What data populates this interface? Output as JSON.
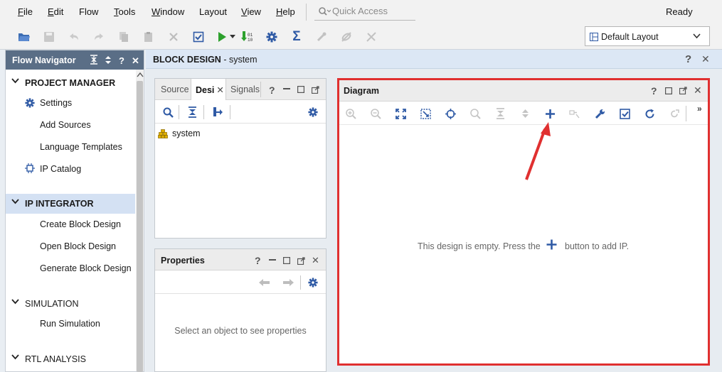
{
  "menu": [
    "File",
    "Edit",
    "Flow",
    "Tools",
    "Window",
    "Layout",
    "View",
    "Help"
  ],
  "menu_mnemonics": [
    "F",
    "E",
    "",
    "T",
    "W",
    "",
    "V",
    "H"
  ],
  "quick_access": {
    "placeholder": "Quick Access"
  },
  "status": "Ready",
  "layout_select": {
    "value": "Default Layout"
  },
  "flow_navigator": {
    "title": "Flow Navigator",
    "sections": [
      {
        "label": "PROJECT MANAGER",
        "items": [
          "Settings",
          "Add Sources",
          "Language Templates",
          "IP Catalog"
        ]
      },
      {
        "label": "IP INTEGRATOR",
        "items": [
          "Create Block Design",
          "Open Block Design",
          "Generate Block Design"
        ]
      },
      {
        "label": "SIMULATION",
        "items": [
          "Run Simulation"
        ]
      },
      {
        "label": "RTL ANALYSIS",
        "items": []
      }
    ]
  },
  "block_design": {
    "title_bold": "BLOCK DESIGN",
    "title_rest": " - system"
  },
  "sources": {
    "tabs": [
      "Source",
      "Desi",
      "Signals"
    ],
    "tree": [
      "system"
    ]
  },
  "properties": {
    "title": "Properties",
    "empty": "Select an object to see properties"
  },
  "diagram": {
    "title": "Diagram",
    "empty_before": "This design is empty. Press the",
    "empty_after": "button to add IP."
  },
  "colors": {
    "nav_header": "#5a6e86",
    "highlight_border": "#e03030",
    "active_section": "#d4e1f3",
    "icon_blue": "#2f5aa5"
  }
}
